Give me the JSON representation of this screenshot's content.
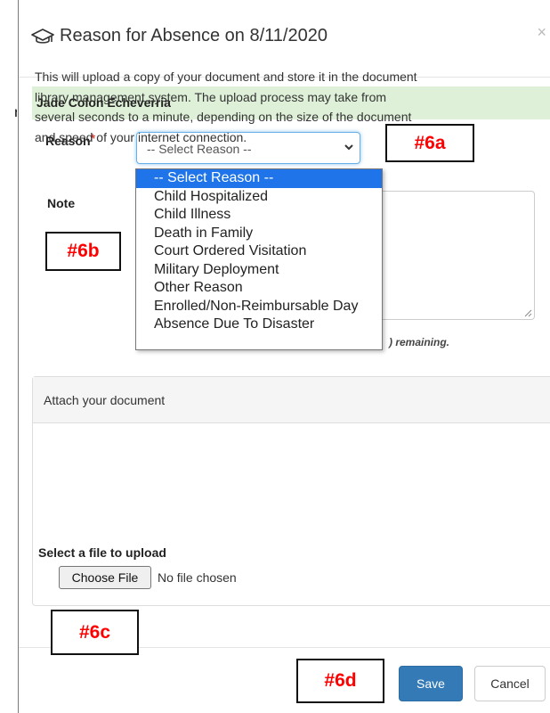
{
  "background_fragment": "n",
  "modal": {
    "title": "Reason for Absence on 8/11/2020",
    "close_label": "×",
    "student_name": "Jade Colon Echeverria",
    "reason_label": "Reason",
    "required_marker": "*",
    "reason_select_value": "-- Select Reason --",
    "reason_options": [
      "-- Select Reason --",
      "Child Hospitalized",
      "Child Illness",
      "Death in Family",
      "Court Ordered Visitation",
      "Military Deployment",
      "Other Reason",
      "Enrolled/Non-Reimbursable Day",
      "Absence Due To Disaster"
    ],
    "note_label": "Note",
    "remaining_text": ") remaining.",
    "attach_heading": "Attach your document",
    "attach_lines": [
      "This will upload a copy of your document and store it in the document",
      "library management system. The upload process may take from",
      "several seconds to a minute, depending on the size of the document",
      "and speed of your internet connection."
    ],
    "upload_label": "Select a file to upload",
    "choose_file_label": "Choose File",
    "file_status": "No file chosen",
    "save_label": "Save",
    "cancel_label": "Cancel"
  },
  "annotations": {
    "a": "#6a",
    "b": "#6b",
    "c": "#6c",
    "d": "#6d"
  },
  "colors": {
    "student_bar": "#dff0d8",
    "primary": "#337ab7",
    "selected_option": "#1e74e8",
    "required": "#e0443d",
    "annotation_text": "#ff0000"
  }
}
